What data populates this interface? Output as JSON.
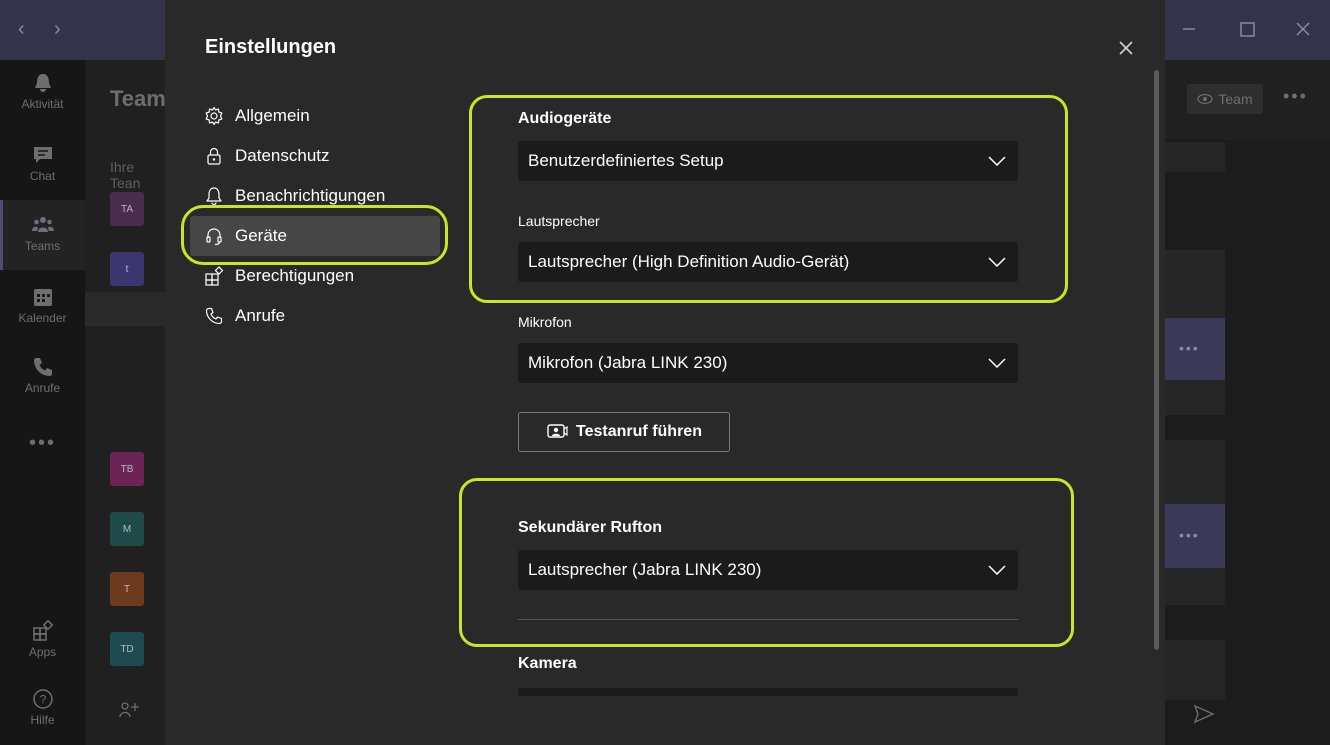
{
  "background": {
    "rail": [
      {
        "label": "Aktivität",
        "icon": "bell-icon"
      },
      {
        "label": "Chat",
        "icon": "chat-icon"
      },
      {
        "label": "Teams",
        "icon": "teams-icon"
      },
      {
        "label": "Kalender",
        "icon": "calendar-icon"
      },
      {
        "label": "Anrufe",
        "icon": "phone-icon"
      },
      {
        "label": "Apps",
        "icon": "apps-icon"
      },
      {
        "label": "Hilfe",
        "icon": "help-icon"
      }
    ],
    "panel_title": "Team",
    "panel_subtitle": "Ihre Tean",
    "team_avatars": [
      {
        "initials": "TA",
        "color": "#4a2c4f"
      },
      {
        "initials": "t",
        "color": "#3b3670"
      },
      {
        "initials": "TB",
        "color": "#6b2456"
      },
      {
        "initials": "M",
        "color": "#1e4a4a"
      },
      {
        "initials": "T",
        "color": "#6e3a1e"
      },
      {
        "initials": "TD",
        "color": "#1e4a52"
      }
    ],
    "right_team_button": "Team"
  },
  "settings": {
    "title": "Einstellungen",
    "nav": [
      {
        "label": "Allgemein",
        "icon": "gear-icon"
      },
      {
        "label": "Datenschutz",
        "icon": "lock-icon"
      },
      {
        "label": "Benachrichtigungen",
        "icon": "bell-icon"
      },
      {
        "label": "Geräte",
        "icon": "headset-icon",
        "active": true
      },
      {
        "label": "Berechtigungen",
        "icon": "permissions-icon"
      },
      {
        "label": "Anrufe",
        "icon": "phone-icon"
      }
    ],
    "audio_devices": {
      "title": "Audiogeräte",
      "value": "Benutzerdefiniertes Setup"
    },
    "speaker": {
      "label": "Lautsprecher",
      "value": "Lautsprecher (High Definition Audio-Gerät)"
    },
    "microphone": {
      "label": "Mikrofon",
      "value": "Mikrofon (Jabra LINK 230)"
    },
    "test_call_button": "Testanruf führen",
    "secondary_ringer": {
      "title": "Sekundärer Rufton",
      "value": "Lautsprecher (Jabra LINK 230)"
    },
    "camera": {
      "title": "Kamera"
    }
  },
  "colors": {
    "highlight": "#c8e626",
    "titlebar": "#33344a",
    "modal": "#292929"
  }
}
